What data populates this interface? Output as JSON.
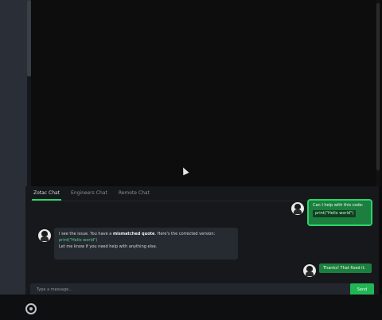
{
  "tabs": [
    {
      "label": "Zotac Chat"
    },
    {
      "label": "Engineers Chat"
    },
    {
      "label": "Remote Chat"
    }
  ],
  "messages": {
    "user1": {
      "text": "Can I help with this code:",
      "code": "print(\"Hello world\")"
    },
    "ai1": {
      "text_before": "I see the issue. You have a ",
      "bold": "mismatched quote",
      "text_after": ". Here's the corrected version:",
      "code": "print(\"Hello world\")",
      "footer": "Let me know if you need help with anything else."
    },
    "user2": {
      "text": "Thanks! That fixed it."
    }
  },
  "input": {
    "placeholder": "Type a message..."
  },
  "send": {
    "label": "Send"
  },
  "colors": {
    "accent": "#2bd46a",
    "user_bubble": "#1d7f3f",
    "ai_bubble": "#262a31"
  }
}
